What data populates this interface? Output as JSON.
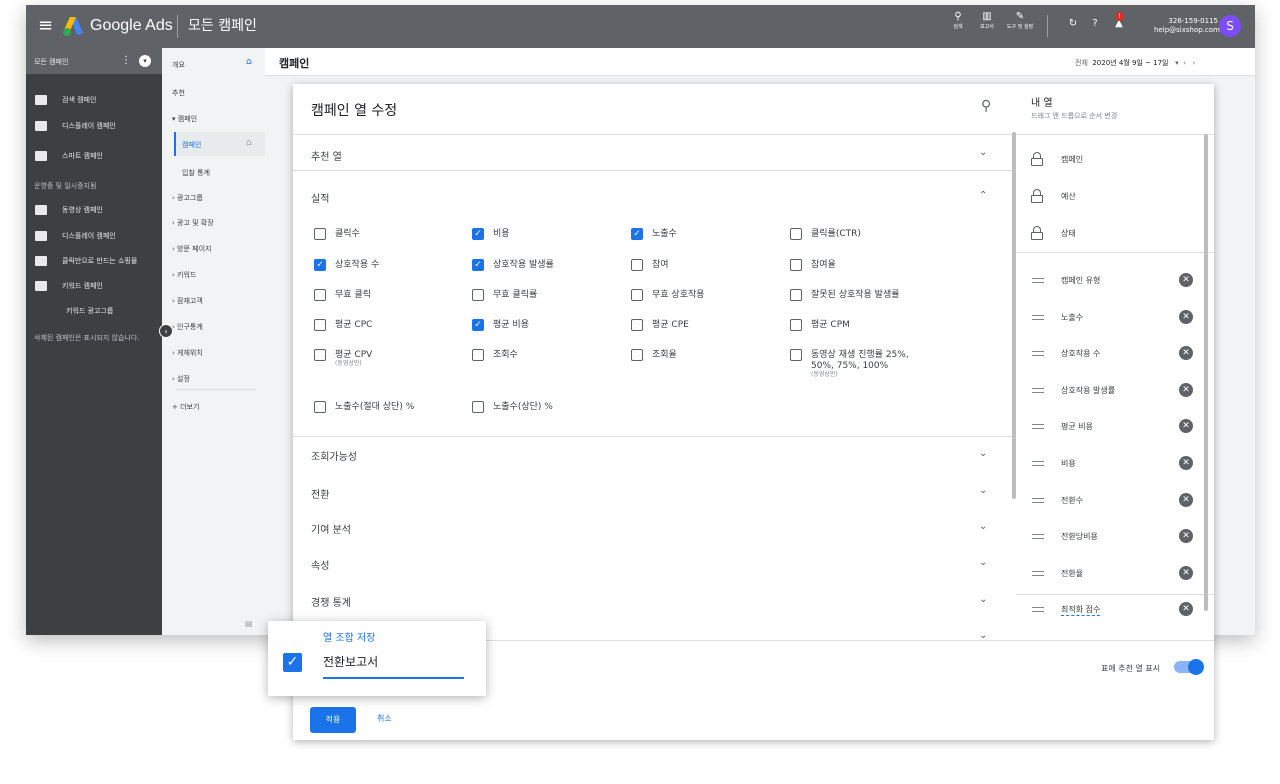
{
  "topbar": {
    "brand": "Google Ads",
    "title": "모든 캠페인",
    "tools": [
      {
        "label": "검색"
      },
      {
        "label": "보고서"
      },
      {
        "label": "도구 및 설정"
      }
    ],
    "notification_badge": "!",
    "account_id": "326-159-0115",
    "account_email": "help@sixshop.com",
    "avatar_letter": "S"
  },
  "leftnav": {
    "header": "모든 캠페인",
    "items": [
      {
        "label": "검색 캠페인"
      },
      {
        "label": "디스플레이 캠페인"
      },
      {
        "label": "스마트 캠페인"
      }
    ],
    "section_label": "운영중 및 일시중지됨",
    "items2": [
      {
        "label": "동영상 캠페인"
      },
      {
        "label": "디스플레이 캠페인"
      },
      {
        "label": "클릭만으로 만드는 쇼핑몰"
      },
      {
        "label": "키워드 캠페인"
      },
      {
        "label": "키워드 광고그룹"
      }
    ],
    "footer": "삭제된 캠페인은 표시되지 않습니다."
  },
  "subnav": {
    "items": [
      {
        "label": "개요"
      },
      {
        "label": "추천"
      },
      {
        "label": "▾ 캠페인"
      },
      {
        "label": "캠페인"
      },
      {
        "label": "입찰 통계"
      },
      {
        "label": "› 광고그룹"
      },
      {
        "label": "› 광고 및 확장"
      },
      {
        "label": "› 방문 페이지"
      },
      {
        "label": "› 키워드"
      },
      {
        "label": "› 잠재고객"
      },
      {
        "label": "› 인구통계"
      },
      {
        "label": "› 게재위치"
      },
      {
        "label": "› 설정"
      }
    ],
    "more": "+  더보기"
  },
  "main": {
    "title": "캠페인",
    "date_prefix": "전체",
    "date_range": "2020년 4월 9일 ~ 17일"
  },
  "dialog": {
    "title": "캠페인 열 수정",
    "sections": {
      "recommended": "추천 열",
      "performance": "실적",
      "viewability": "조회가능성",
      "conversions": "전환",
      "attribution": "기여 분석",
      "attributes": "속성",
      "competitive": "경쟁 통계"
    },
    "checkboxes": [
      {
        "label": "클릭수",
        "checked": false
      },
      {
        "label": "비용",
        "checked": true
      },
      {
        "label": "노출수",
        "checked": true
      },
      {
        "label": "클릭률(CTR)",
        "checked": false
      },
      {
        "label": "상호작용 수",
        "checked": true
      },
      {
        "label": "상호작용 발생률",
        "checked": true
      },
      {
        "label": "참여",
        "checked": false
      },
      {
        "label": "참여율",
        "checked": false
      },
      {
        "label": "무효 클릭",
        "checked": false
      },
      {
        "label": "무효 클릭률",
        "checked": false
      },
      {
        "label": "무효 상호작용",
        "checked": false
      },
      {
        "label": "잘못된 상호작용 발생률",
        "checked": false
      },
      {
        "label": "평균 CPC",
        "checked": false
      },
      {
        "label": "평균 비용",
        "checked": true
      },
      {
        "label": "평균 CPE",
        "checked": false
      },
      {
        "label": "평균 CPM",
        "checked": false
      },
      {
        "label": "평균 CPV",
        "sublabel": "(동영상만)",
        "checked": false
      },
      {
        "label": "조회수",
        "checked": false
      },
      {
        "label": "조회율",
        "checked": false
      },
      {
        "label": "동영상 재생 진행률 25%,",
        "label2": "50%, 75%, 100%",
        "sublabel": "(동영상만)",
        "checked": false
      },
      {
        "label": "노출수(절대 상단) %",
        "checked": false
      },
      {
        "label": "노출수(상단) %",
        "checked": false
      }
    ],
    "my_columns": {
      "title": "내 열",
      "subtitle": "드래그 앤 드롭으로 순서 변경",
      "locked": [
        "캠페인",
        "예산",
        "상태"
      ],
      "movable": [
        "캠페인 유형",
        "노출수",
        "상호작용 수",
        "상호작용 발생률",
        "평균 비용",
        "비용",
        "전환수",
        "전환당비용",
        "전환율",
        "최적화 점수"
      ]
    },
    "toggle_label": "표에 추천 열 표시",
    "toggle_on": true,
    "apply": "적용",
    "cancel": "취소"
  },
  "popup": {
    "label": "열 조합 저장",
    "value": "전환보고서",
    "checked": true
  }
}
